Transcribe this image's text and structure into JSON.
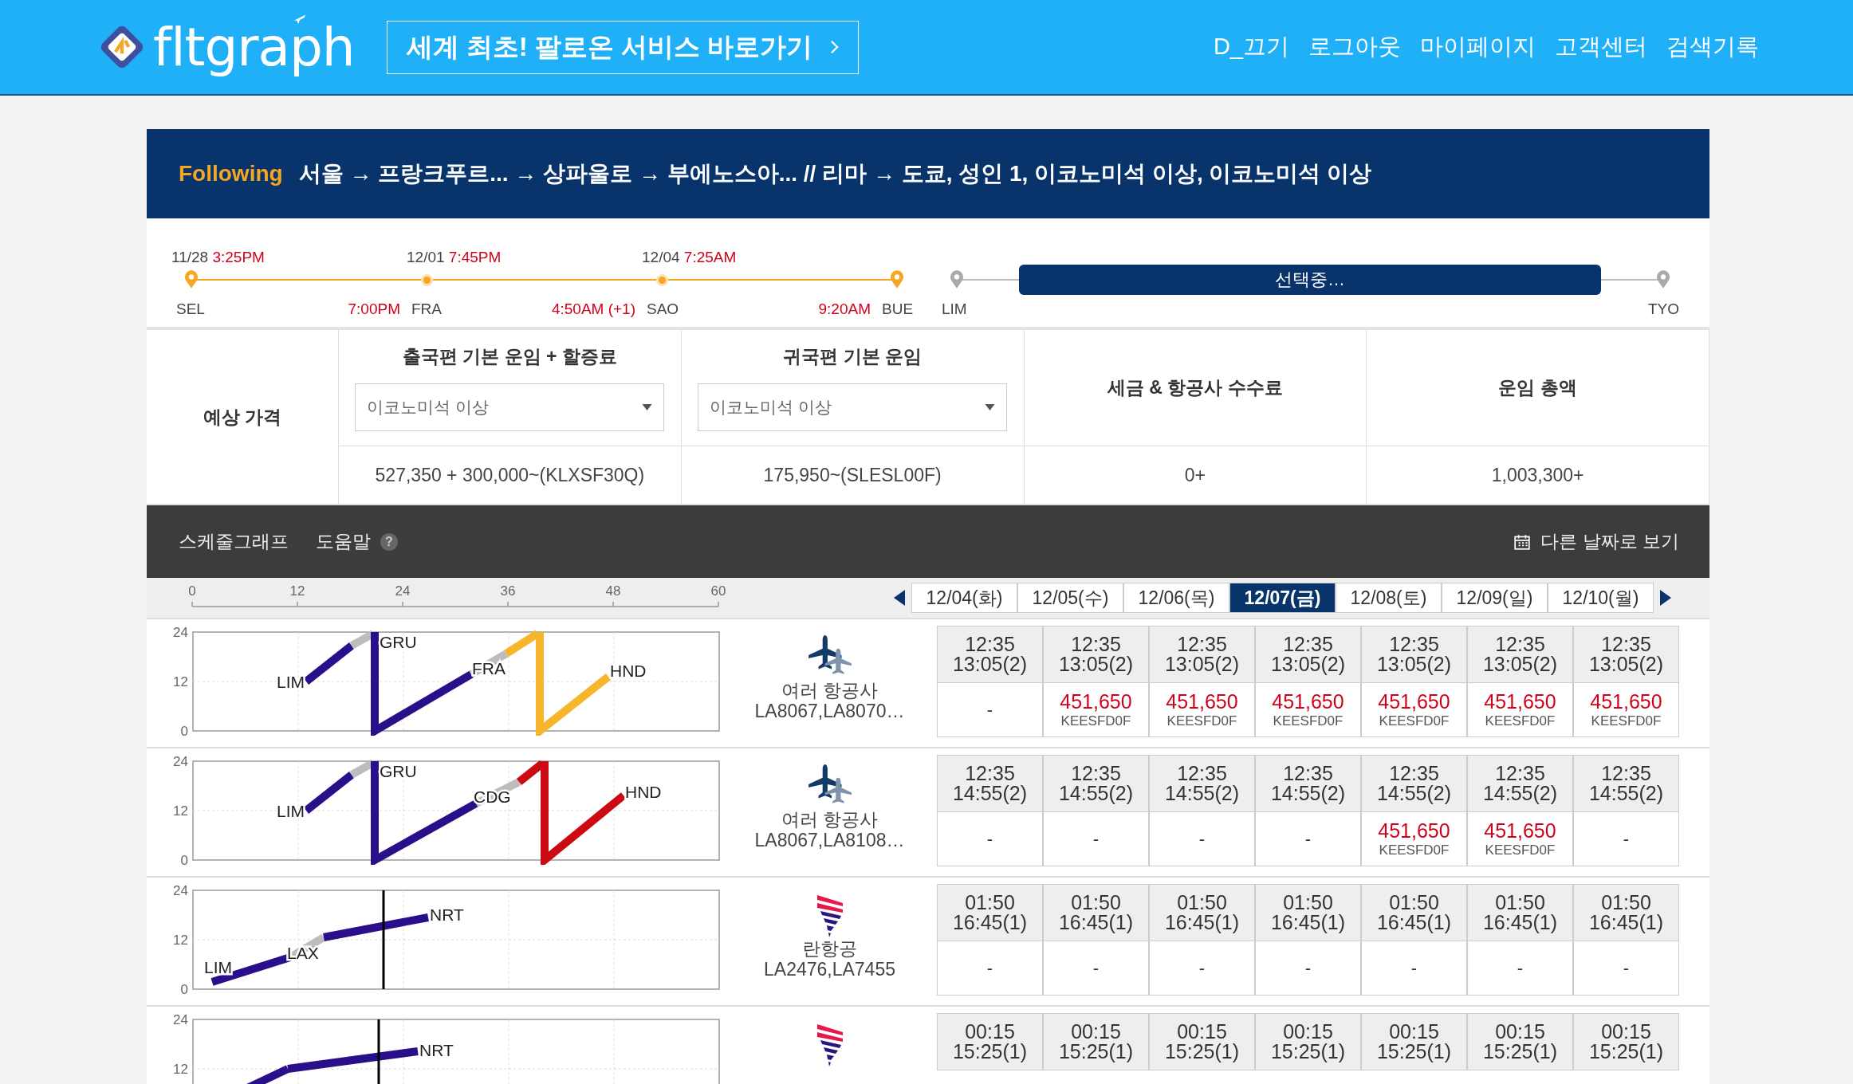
{
  "header": {
    "logo_text": "fltgraph",
    "promo": "세계 최초! 팔로온 서비스 바로가기",
    "nav": [
      "D_끄기",
      "로그아웃",
      "마이페이지",
      "고객센터",
      "검색기록"
    ]
  },
  "route_bar": {
    "tag": "Following",
    "summary": "서울 → 프랑크푸르... → 상파울로 → 부에노스아... // 리마 → 도쿄, 성인 1, 이코노미석 이상, 이코노미석 이상"
  },
  "timeline": {
    "nodes": [
      {
        "code": "SEL",
        "kind": "pin",
        "confirmed": true
      },
      {
        "code": "FRA",
        "kind": "dot",
        "confirmed": true
      },
      {
        "code": "SAO",
        "kind": "dot",
        "confirmed": true
      },
      {
        "code": "BUE",
        "kind": "pin",
        "confirmed": true
      },
      {
        "code": "LIM",
        "kind": "pin",
        "confirmed": false
      },
      {
        "code": "TYO",
        "kind": "pin",
        "confirmed": false
      }
    ],
    "legs": [
      {
        "kind": "flight",
        "date": "11/28",
        "depart": "3:25PM",
        "arrive": "7:00PM"
      },
      {
        "kind": "flight",
        "date": "12/01",
        "depart": "7:45PM",
        "arrive": "4:50AM (+1)"
      },
      {
        "kind": "flight",
        "date": "12/04",
        "depart": "7:25AM",
        "arrive": "9:20AM"
      },
      {
        "kind": "break"
      },
      {
        "kind": "selecting",
        "status": "선택중…"
      }
    ]
  },
  "fare_table": {
    "label": "예상 가격",
    "columns": [
      {
        "title": "출국편 기본 운임 + 할증료",
        "select": "이코노미석 이상",
        "value": "527,350 + 300,000~(KLXSF30Q)"
      },
      {
        "title": "귀국편 기본 운임",
        "select": "이코노미석 이상",
        "value": "175,950~(SLESL00F)"
      },
      {
        "title": "세금 & 항공사 수수료",
        "value": "0+"
      },
      {
        "title": "운임 총액",
        "value": "1,003,300+"
      }
    ]
  },
  "schedule": {
    "title": "스케줄그래프",
    "help": "도움말",
    "help_icon": "?",
    "other_dates": "다른 날짜로 보기",
    "axis_ticks": [
      "0",
      "12",
      "24",
      "36",
      "48",
      "60"
    ],
    "dates": [
      {
        "label": "12/04(화)",
        "selected": false
      },
      {
        "label": "12/05(수)",
        "selected": false
      },
      {
        "label": "12/06(목)",
        "selected": false
      },
      {
        "label": "12/07(금)",
        "selected": true
      },
      {
        "label": "12/08(토)",
        "selected": false
      },
      {
        "label": "12/09(일)",
        "selected": false
      },
      {
        "label": "12/10(월)",
        "selected": false
      }
    ],
    "rows": [
      {
        "y_ticks": [
          "24",
          "12",
          "0"
        ],
        "stops": [
          "LIM",
          "GRU",
          "FRA",
          "HND"
        ],
        "kind": "multi",
        "airline": "여러 항공사",
        "flights": "LA8067,LA8070…",
        "cells": [
          {
            "depart": "12:35",
            "arrive": "13:05(2)",
            "kind": "none",
            "text": "-"
          },
          {
            "depart": "12:35",
            "arrive": "13:05(2)",
            "kind": "fare",
            "price": "451,650",
            "code": "KEESFD0F"
          },
          {
            "depart": "12:35",
            "arrive": "13:05(2)",
            "kind": "fare",
            "price": "451,650",
            "code": "KEESFD0F"
          },
          {
            "depart": "12:35",
            "arrive": "13:05(2)",
            "kind": "fare",
            "price": "451,650",
            "code": "KEESFD0F"
          },
          {
            "depart": "12:35",
            "arrive": "13:05(2)",
            "kind": "fare",
            "price": "451,650",
            "code": "KEESFD0F"
          },
          {
            "depart": "12:35",
            "arrive": "13:05(2)",
            "kind": "fare",
            "price": "451,650",
            "code": "KEESFD0F"
          },
          {
            "depart": "12:35",
            "arrive": "13:05(2)",
            "kind": "fare",
            "price": "451,650",
            "code": "KEESFD0F"
          }
        ]
      },
      {
        "y_ticks": [
          "24",
          "12",
          "0"
        ],
        "stops": [
          "LIM",
          "GRU",
          "CDG",
          "HND"
        ],
        "kind": "multi",
        "airline": "여러 항공사",
        "flights": "LA8067,LA8108…",
        "cells": [
          {
            "depart": "12:35",
            "arrive": "14:55(2)",
            "kind": "none",
            "text": "-"
          },
          {
            "depart": "12:35",
            "arrive": "14:55(2)",
            "kind": "none",
            "text": "-"
          },
          {
            "depart": "12:35",
            "arrive": "14:55(2)",
            "kind": "none",
            "text": "-"
          },
          {
            "depart": "12:35",
            "arrive": "14:55(2)",
            "kind": "none",
            "text": "-"
          },
          {
            "depart": "12:35",
            "arrive": "14:55(2)",
            "kind": "fare",
            "price": "451,650",
            "code": "KEESFD0F"
          },
          {
            "depart": "12:35",
            "arrive": "14:55(2)",
            "kind": "fare",
            "price": "451,650",
            "code": "KEESFD0F"
          },
          {
            "depart": "12:35",
            "arrive": "14:55(2)",
            "kind": "none",
            "text": "-"
          }
        ]
      },
      {
        "y_ticks": [
          "24",
          "12",
          "0"
        ],
        "stops": [
          "LIM",
          "LAX",
          "NRT"
        ],
        "kind": "stripes",
        "airline": "란항공",
        "flights": "LA2476,LA7455",
        "cells": [
          {
            "depart": "01:50",
            "arrive": "16:45(1)",
            "kind": "none",
            "text": "-"
          },
          {
            "depart": "01:50",
            "arrive": "16:45(1)",
            "kind": "none",
            "text": "-"
          },
          {
            "depart": "01:50",
            "arrive": "16:45(1)",
            "kind": "none",
            "text": "-"
          },
          {
            "depart": "01:50",
            "arrive": "16:45(1)",
            "kind": "none",
            "text": "-"
          },
          {
            "depart": "01:50",
            "arrive": "16:45(1)",
            "kind": "none",
            "text": "-"
          },
          {
            "depart": "01:50",
            "arrive": "16:45(1)",
            "kind": "none",
            "text": "-"
          },
          {
            "depart": "01:50",
            "arrive": "16:45(1)",
            "kind": "none",
            "text": "-"
          }
        ]
      },
      {
        "y_ticks": [
          "24",
          "12"
        ],
        "stops": [
          "NRT"
        ],
        "kind": "stripes",
        "cells": [
          {
            "depart": "00:15",
            "arrive": "15:25(1)"
          },
          {
            "depart": "00:15",
            "arrive": "15:25(1)"
          },
          {
            "depart": "00:15",
            "arrive": "15:25(1)"
          },
          {
            "depart": "00:15",
            "arrive": "15:25(1)"
          },
          {
            "depart": "00:15",
            "arrive": "15:25(1)"
          },
          {
            "depart": "00:15",
            "arrive": "15:25(1)"
          },
          {
            "depart": "00:15",
            "arrive": "15:25(1)"
          }
        ]
      }
    ]
  }
}
